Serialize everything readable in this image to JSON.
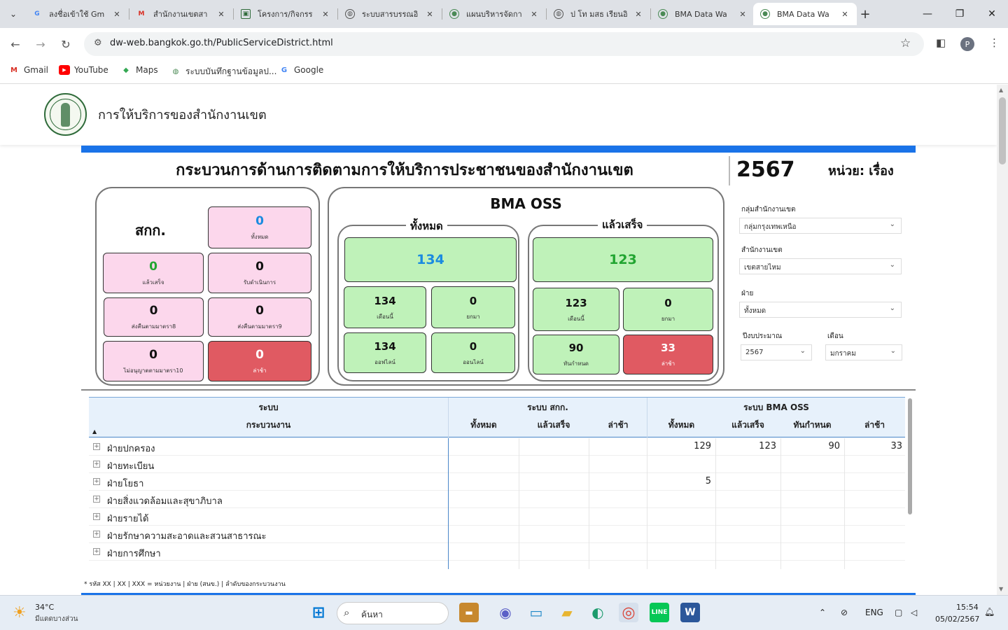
{
  "browser": {
    "tabs": [
      {
        "title": "ลงชื่อเข้าใช้ Gm",
        "icon": "google-icon"
      },
      {
        "title": "สำนักงานเขตสา",
        "icon": "gmail-icon"
      },
      {
        "title": "โครงการ/กิจกรร",
        "icon": "doc-icon"
      },
      {
        "title": "ระบบสารบรรณอิ",
        "icon": "globe-icon"
      },
      {
        "title": "แผนบริหารจัดกา",
        "icon": "bma-icon"
      },
      {
        "title": "ป โท มสธ เรียนอิ",
        "icon": "globe-icon"
      },
      {
        "title": "BMA Data Wa",
        "icon": "bma-icon"
      },
      {
        "title": "BMA Data Wa",
        "icon": "bma-icon",
        "active": true
      }
    ],
    "url": "dw-web.bangkok.go.th/PublicServiceDistrict.html",
    "profile_initial": "P",
    "bookmarks": [
      {
        "label": "Gmail",
        "icon": "gmail-icon"
      },
      {
        "label": "YouTube",
        "icon": "youtube-icon"
      },
      {
        "label": "Maps",
        "icon": "maps-icon"
      },
      {
        "label": "ระบบบันทึกฐานข้อมูลป...",
        "icon": "bma-icon"
      },
      {
        "label": "Google",
        "icon": "google-icon"
      }
    ]
  },
  "site": {
    "title": "การให้บริการของสำนักงานเขต"
  },
  "dashboard": {
    "main_title": "กระบวนการด้านการติดตามการให้บริการประชาชนของสำนักงานเขต",
    "year": "2567",
    "unit": "หน่วย: เรื่อง",
    "skk": {
      "title": "สกก.",
      "total": {
        "value": "0",
        "caption": "ทั้งหมด"
      },
      "done": {
        "value": "0",
        "caption": "แล้วเสร็จ"
      },
      "accepted": {
        "value": "0",
        "caption": "รับดำเนินการ"
      },
      "return8": {
        "value": "0",
        "caption": "ส่งคืนตามมาตรา8"
      },
      "return9": {
        "value": "0",
        "caption": "ส่งคืนตามมาตรา9"
      },
      "denied10": {
        "value": "0",
        "caption": "ไม่อนุญาตตามมาตรา10"
      },
      "late": {
        "value": "0",
        "caption": "ล่าช้า"
      }
    },
    "oss": {
      "title": "BMA OSS",
      "all": {
        "legend": "ทั้งหมด",
        "total": "134",
        "this_month": {
          "value": "134",
          "caption": "เดือนนี้"
        },
        "cancelled": {
          "value": "0",
          "caption": "ยกมา"
        },
        "offline": {
          "value": "134",
          "caption": "ออฟไลน์"
        },
        "online": {
          "value": "0",
          "caption": "ออนไลน์"
        }
      },
      "done": {
        "legend": "แล้วเสร็จ",
        "total": "123",
        "this_month": {
          "value": "123",
          "caption": "เดือนนี้"
        },
        "cancelled": {
          "value": "0",
          "caption": "ยกมา"
        },
        "on_time": {
          "value": "90",
          "caption": "ทันกำหนด"
        },
        "late": {
          "value": "33",
          "caption": "ล่าช้า"
        }
      }
    },
    "filters": {
      "group_label": "กลุ่มสำนักงานเขต",
      "group_value": "กลุ่มกรุงเทพเหนือ",
      "district_label": "สำนักงานเขต",
      "district_value": "เขตสายไหม",
      "division_label": "ฝ่าย",
      "division_value": "ทั้งหมด",
      "fiscal_label": "ปีงบประมาณ",
      "fiscal_value": "2567",
      "month_label": "เดือน",
      "month_value": "มกราคม"
    }
  },
  "table": {
    "group_headers": {
      "system": "ระบบ",
      "skk": "ระบบ สกก.",
      "oss": "ระบบ BMA OSS"
    },
    "columns": {
      "process": "กระบวนงาน",
      "skk_total": "ทั้งหมด",
      "skk_done": "แล้วเสร็จ",
      "skk_late": "ล่าช้า",
      "oss_total": "ทั้งหมด",
      "oss_done": "แล้วเสร็จ",
      "oss_ontime": "ทันกำหนด",
      "oss_late": "ล่าช้า"
    },
    "rows": [
      {
        "name": "ฝ่ายปกครอง",
        "skk_total": "",
        "skk_done": "",
        "skk_late": "",
        "oss_total": "129",
        "oss_done": "123",
        "oss_ontime": "90",
        "oss_late": "33"
      },
      {
        "name": "ฝ่ายทะเบียน",
        "skk_total": "",
        "skk_done": "",
        "skk_late": "",
        "oss_total": "",
        "oss_done": "",
        "oss_ontime": "",
        "oss_late": ""
      },
      {
        "name": "ฝ่ายโยธา",
        "skk_total": "",
        "skk_done": "",
        "skk_late": "",
        "oss_total": "5",
        "oss_done": "",
        "oss_ontime": "",
        "oss_late": ""
      },
      {
        "name": "ฝ่ายสิ่งแวดล้อมและสุขาภิบาล",
        "skk_total": "",
        "skk_done": "",
        "skk_late": "",
        "oss_total": "",
        "oss_done": "",
        "oss_ontime": "",
        "oss_late": ""
      },
      {
        "name": "ฝ่ายรายได้",
        "skk_total": "",
        "skk_done": "",
        "skk_late": "",
        "oss_total": "",
        "oss_done": "",
        "oss_ontime": "",
        "oss_late": ""
      },
      {
        "name": "ฝ่ายรักษาความสะอาดและสวนสาธารณะ",
        "skk_total": "",
        "skk_done": "",
        "skk_late": "",
        "oss_total": "",
        "oss_done": "",
        "oss_ontime": "",
        "oss_late": ""
      },
      {
        "name": "ฝ่ายการศึกษา",
        "skk_total": "",
        "skk_done": "",
        "skk_late": "",
        "oss_total": "",
        "oss_done": "",
        "oss_ontime": "",
        "oss_late": ""
      }
    ],
    "footnote": "* รหัส XX | XX | XXX = หน่วยงาน | ฝ่าย (สนข.) | ลำดับของกระบวนงาน"
  },
  "taskbar": {
    "temperature": "34°C",
    "weather": "มีแดดบางส่วน",
    "search_placeholder": "ค้นหา",
    "language": "ENG",
    "time": "15:54",
    "date": "05/02/2567"
  },
  "colors": {
    "accent_blue": "#1a73e8",
    "card_pink": "#fcd7ec",
    "card_green": "#bff2b9",
    "card_red": "#e05a62"
  }
}
